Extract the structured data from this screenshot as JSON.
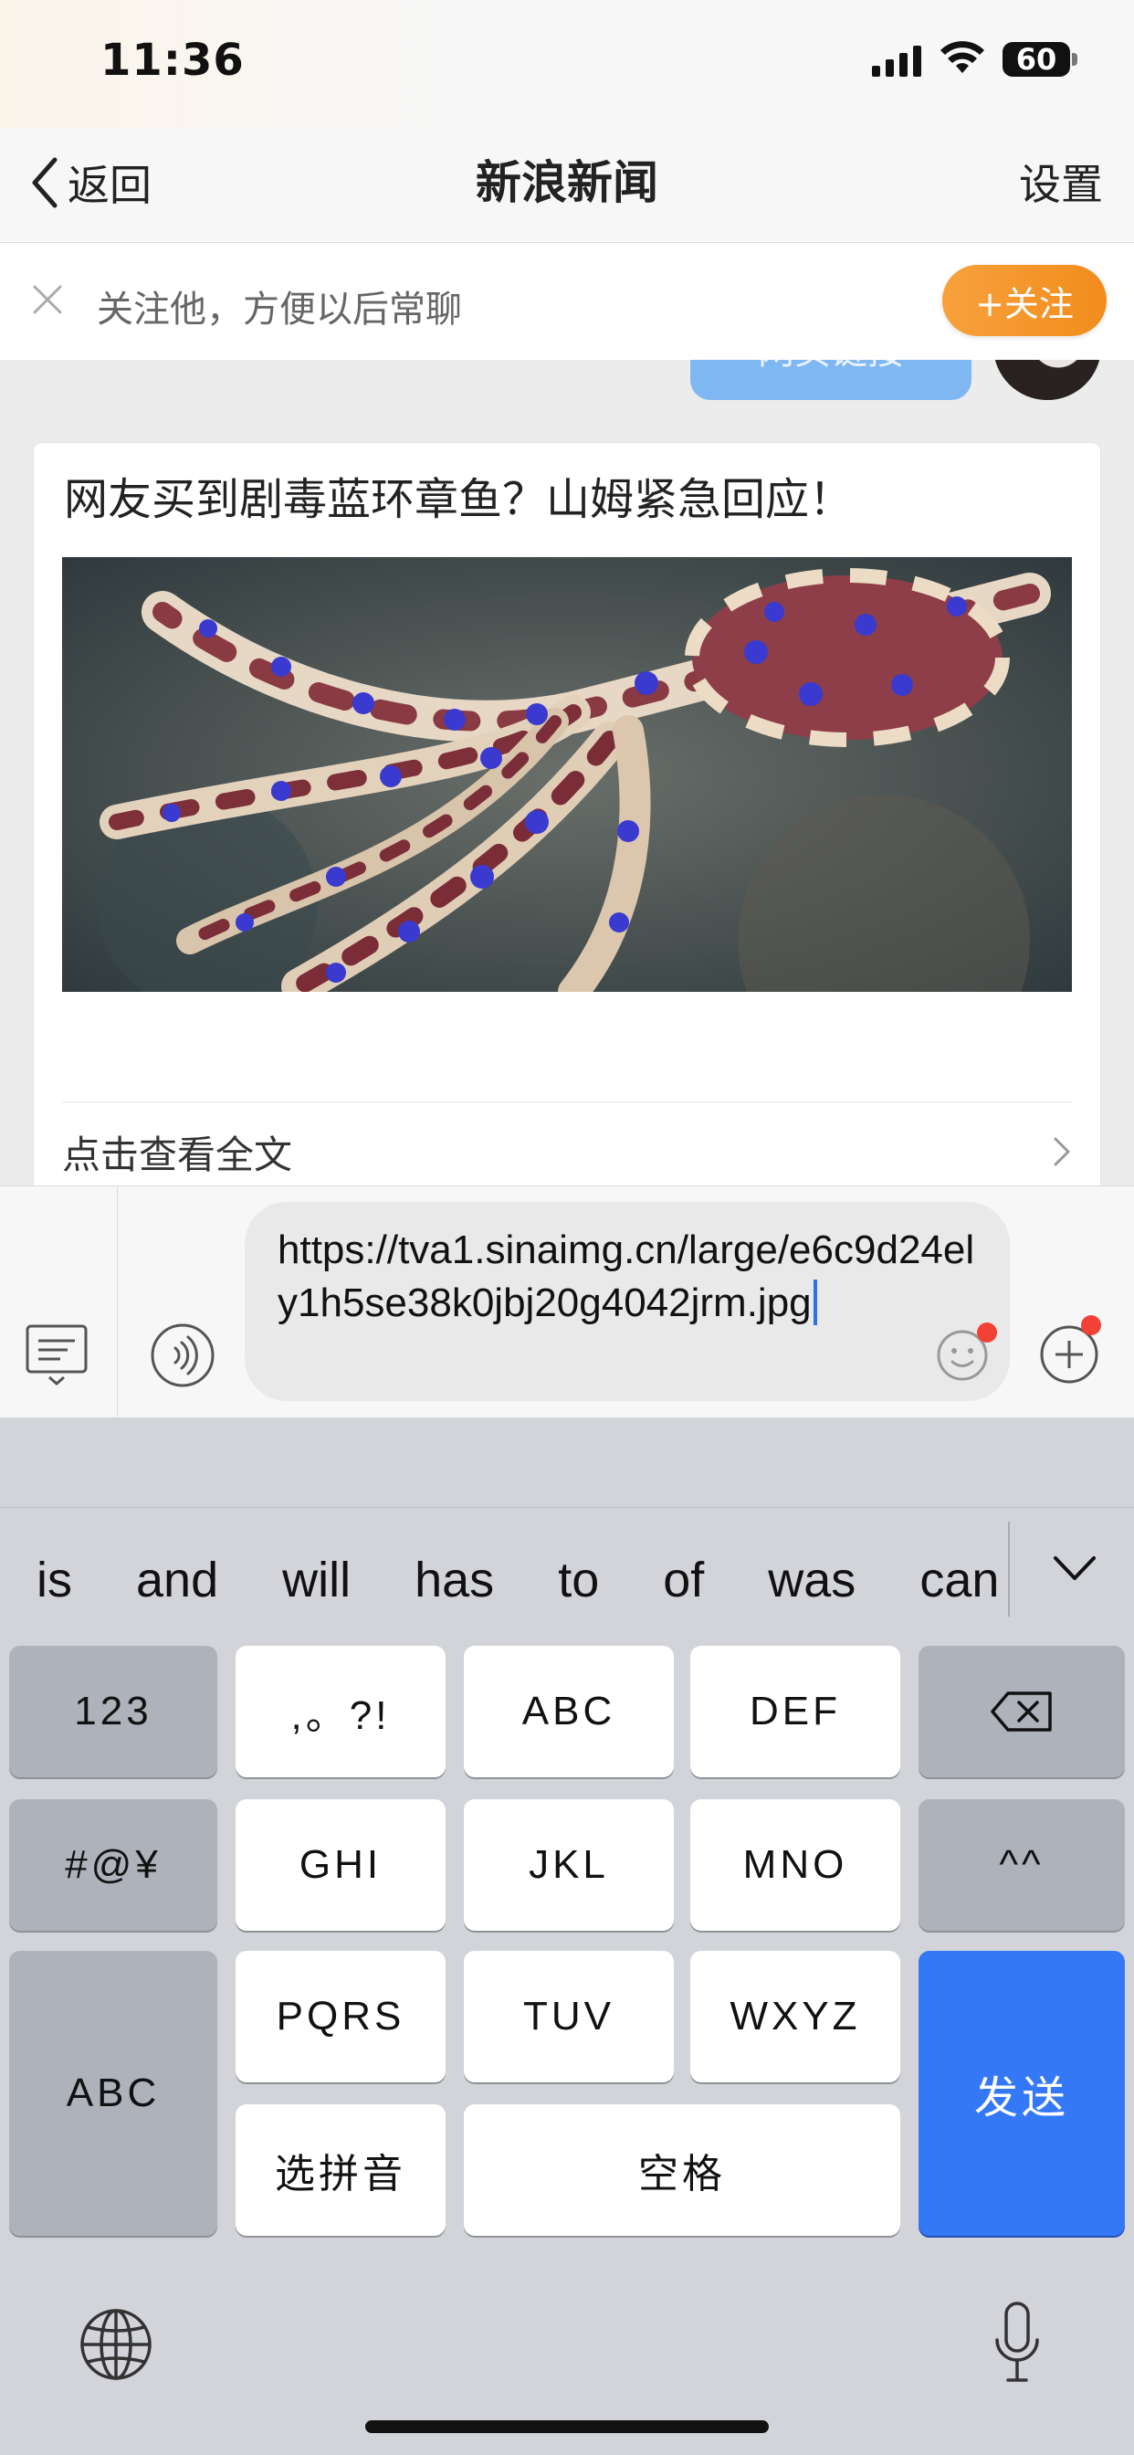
{
  "status_bar": {
    "time": "11:36",
    "battery": "60"
  },
  "nav": {
    "back_label": "返回",
    "title": "新浪新闻",
    "settings_label": "设置"
  },
  "follow_banner": {
    "text": "关注他，方便以后常聊",
    "follow_button": "+关注",
    "peek_bubble_text": "网页链接"
  },
  "article": {
    "title": "网友买到剧毒蓝环章鱼？山姆紧急回应！",
    "image_subject": "blue-ringed octopus photo",
    "read_more": "点击查看全文"
  },
  "input": {
    "value": "https://tva1.sinaimg.cn/large/e6c9d24ely1h5se38k0jbj20g4042jrm.jpg"
  },
  "suggestions": [
    "is",
    "and",
    "will",
    "has",
    "to",
    "of",
    "was",
    "can"
  ],
  "keyboard": {
    "row1": {
      "k1": "123",
      "k2": ",。?!",
      "k3": "ABC",
      "k4": "DEF"
    },
    "row2": {
      "k1": "#@¥",
      "k2": "GHI",
      "k3": "JKL",
      "k4": "MNO",
      "k5": "^^"
    },
    "row3": {
      "k1": "ABC",
      "k2": "PQRS",
      "k3": "TUV",
      "k4": "WXYZ",
      "send": "发送"
    },
    "row4": {
      "k1": "选拼音",
      "space": "空格"
    }
  },
  "colors": {
    "accent_orange": "#f28c1c",
    "send_blue": "#3578f6",
    "badge_red": "#f24236"
  }
}
